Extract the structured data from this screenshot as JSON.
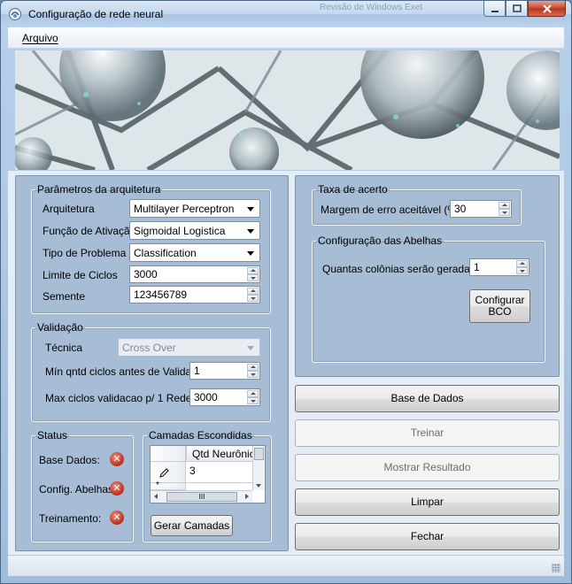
{
  "window": {
    "title": "Configuração de rede neural",
    "ghost_title": "Revisão de Windows Exet"
  },
  "menu": {
    "file_label": "Arquivo"
  },
  "architecture": {
    "legend": "Parâmetros da arquitetura",
    "arch_label": "Arquitetura",
    "arch_value": "Multilayer Perceptron",
    "activation_label": "Função de Ativação",
    "activation_value": "Sigmoidal Logistica",
    "problem_label": "Tipo de Problema",
    "problem_value": "Classification",
    "cycles_label": "Limite de Ciclos",
    "cycles_value": "3000",
    "seed_label": "Semente",
    "seed_value": "123456789"
  },
  "validation": {
    "legend": "Validação",
    "technique_label": "Técnica",
    "technique_value": "Cross Over",
    "min_label": "Mín qntd ciclos antes de Validar",
    "min_value": "1",
    "max_label": "Max ciclos validacao p/ 1 Rede",
    "max_value": "3000"
  },
  "status": {
    "legend": "Status",
    "database_label": "Base Dados:",
    "bees_label": "Config. Abelhas.:",
    "training_label": "Treinamento:"
  },
  "hidden_layers": {
    "legend": "Camadas Escondidas",
    "column_header": "Qtd Neurônios",
    "rows": [
      "3"
    ],
    "scroll_thumb_glyph": "III",
    "generate_button": "Gerar Camadas"
  },
  "accuracy": {
    "legend": "Taxa de acerto",
    "margin_label": "Margem de erro aceitável (%)",
    "margin_value": "30"
  },
  "bees": {
    "legend": "Configuração das Abelhas",
    "colonies_label": "Quantas colônias serão geradas?",
    "colonies_value": "1",
    "configure_button_line1": "Configurar",
    "configure_button_line2": "BCO"
  },
  "actions": {
    "database": "Base de Dados",
    "train": "Treinar",
    "show_result": "Mostrar Resultado",
    "clear": "Limpar",
    "close": "Fechar"
  },
  "colors": {
    "panel": "#a6bdd5",
    "error_icon": "#c23a24",
    "titlebar": "#c3d7ee"
  }
}
